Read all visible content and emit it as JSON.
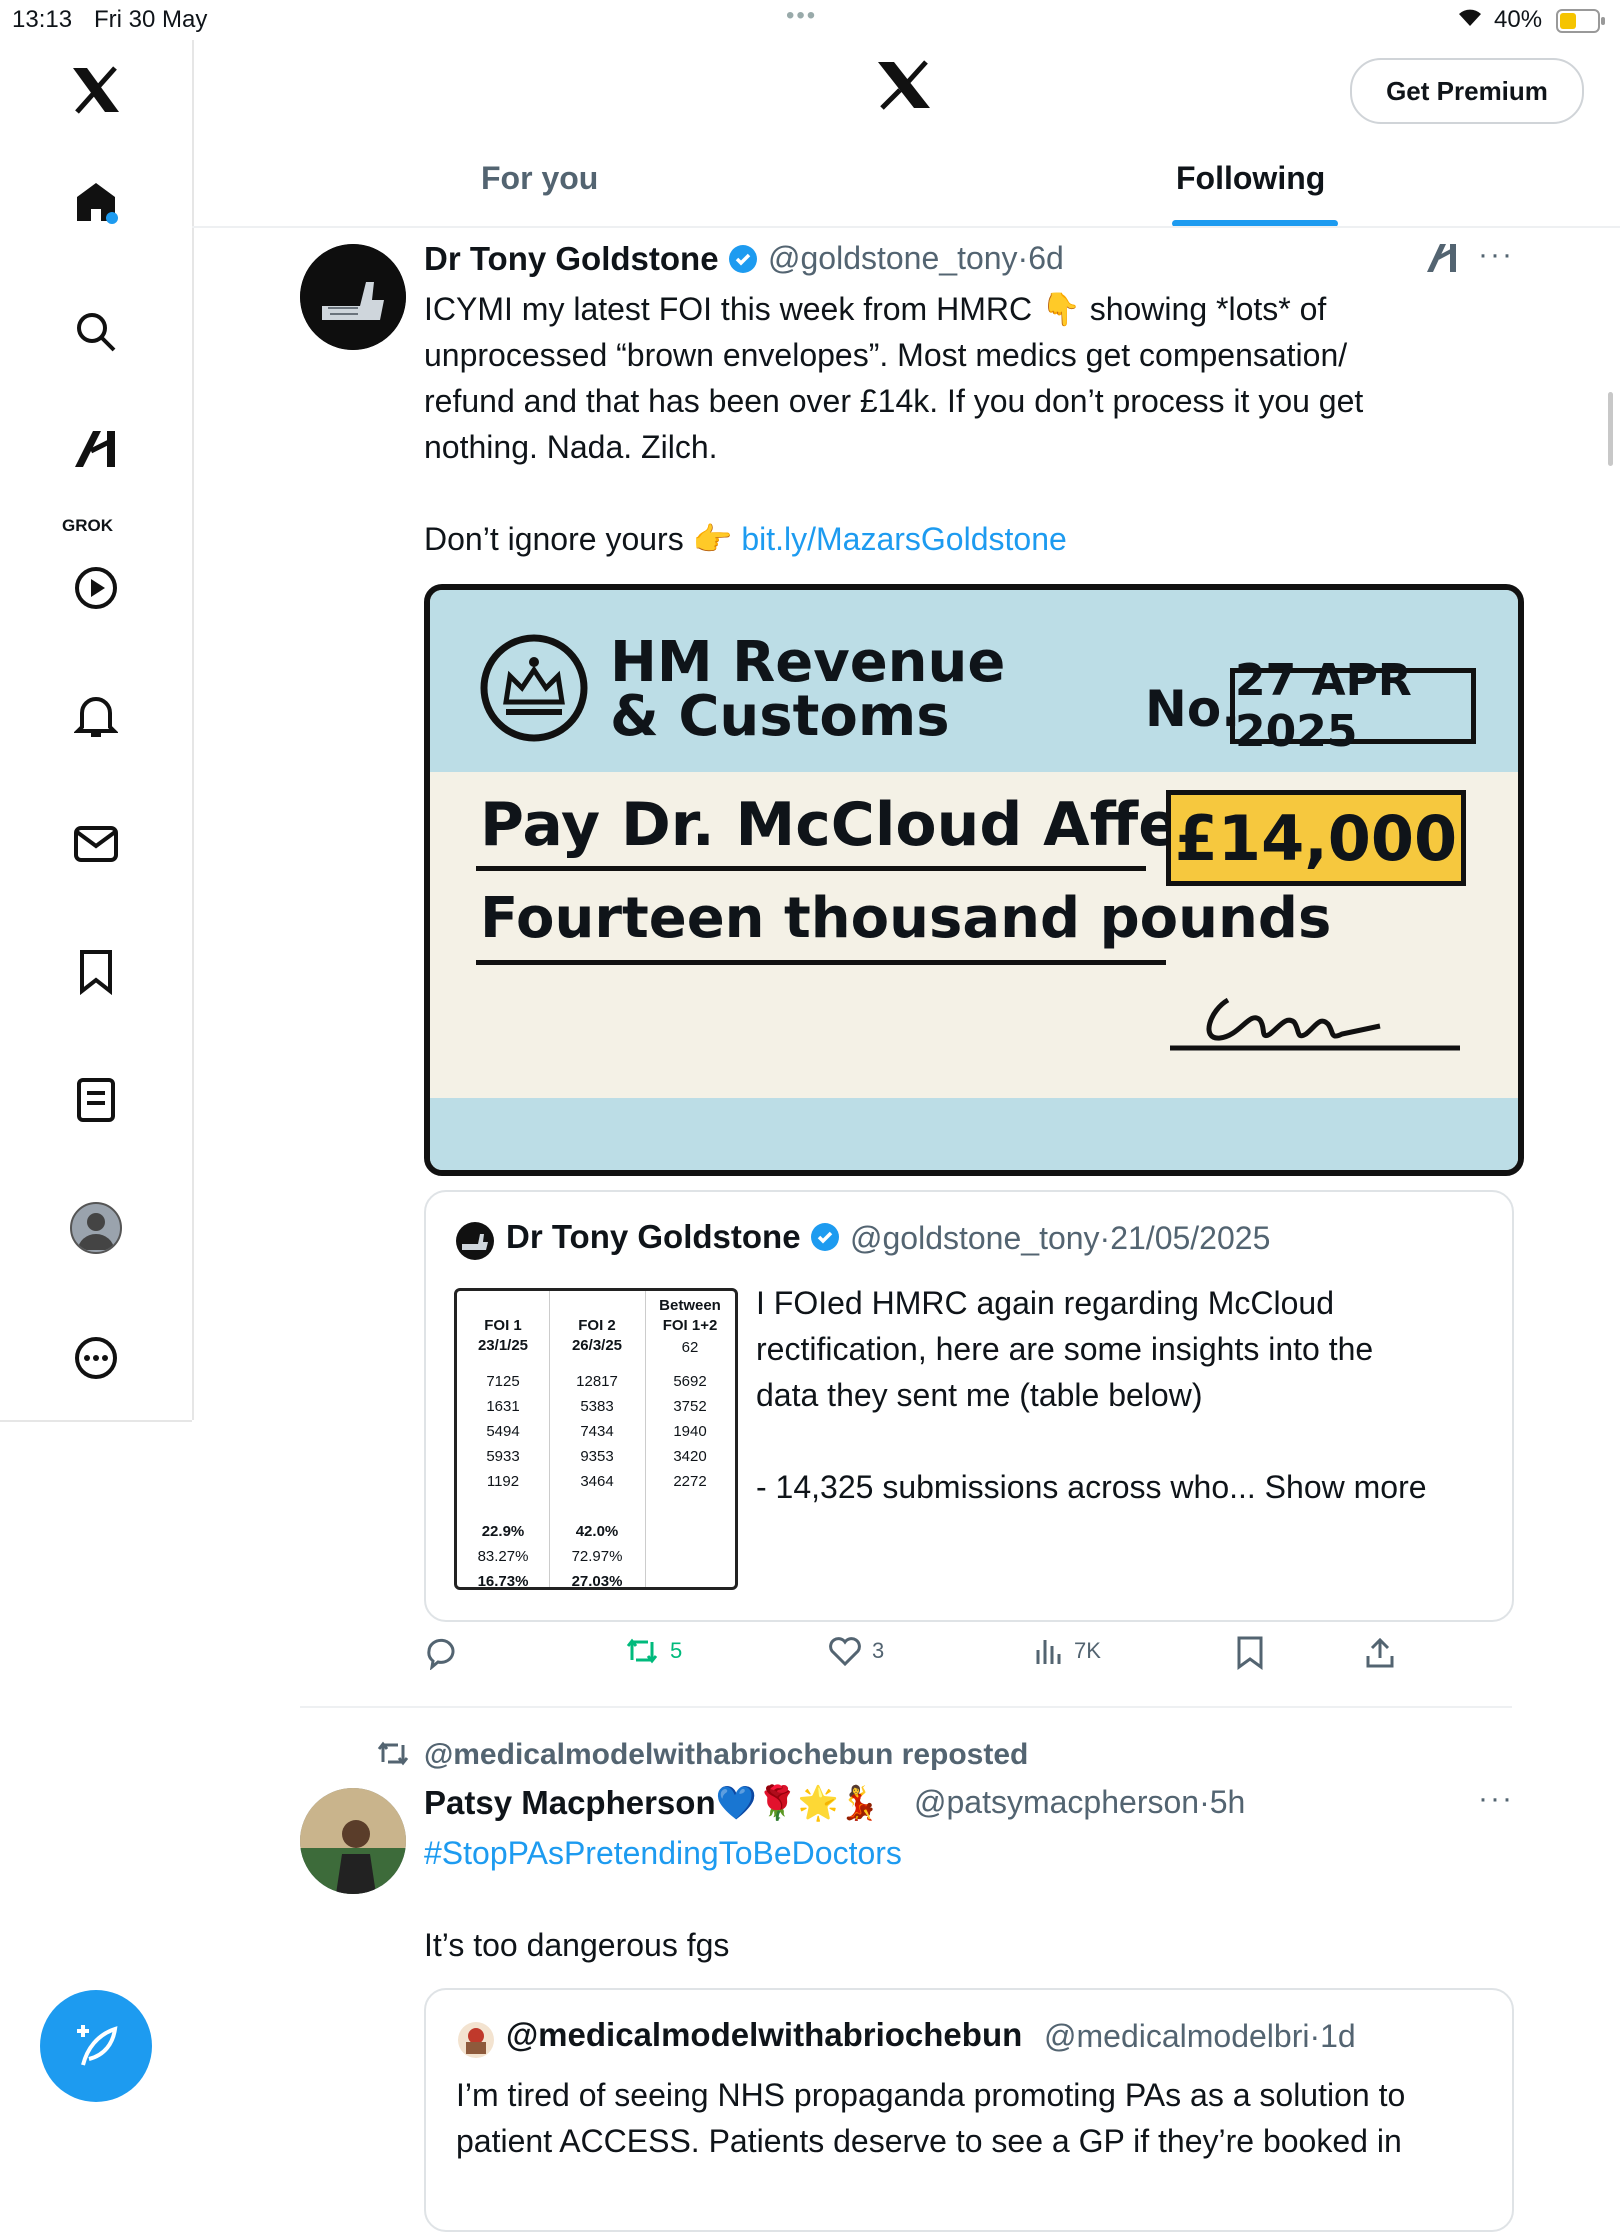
{
  "status_bar": {
    "time": "13:13",
    "date": "Fri 30 May",
    "battery": "40%"
  },
  "nav": {
    "items": [
      "home",
      "explore",
      "grok",
      "video",
      "notifications",
      "messages",
      "bookmarks",
      "lists",
      "profile",
      "more"
    ],
    "grok_label": "GROK"
  },
  "header": {
    "premium_button": "Get Premium",
    "tabs": [
      "For you",
      "Following"
    ],
    "active_tab": "Following"
  },
  "post1": {
    "name": "Dr Tony Goldstone",
    "handle": "@goldstone_tony",
    "time": "6d",
    "text_lines": [
      "ICYMI my latest FOI this week from HMRC 👇 showing *lots* of",
      "unprocessed “brown envelopes”. Most medics get compensation/",
      "refund and that has been over £14k. If you don’t process it you get",
      "nothing. Nada. Zilch."
    ],
    "cta_text": "Don’t ignore yours 👉 ",
    "link": "bit.ly/MazarsGoldstone",
    "cheque": {
      "issuer_line1": "HM Revenue",
      "issuer_line2": "& Customs",
      "no_label": "No.",
      "date": "27 APR 2025",
      "pay_line": "Pay Dr. McCloud Affected",
      "amount": "£14,000",
      "amount_words": "Fourteen thousand pounds"
    },
    "quote": {
      "name": "Dr Tony Goldstone",
      "handle": "@goldstone_tony",
      "date": "21/05/2025",
      "text_lines": [
        "I FOIed HMRC again regarding McCloud",
        "rectification, here are some insights into the",
        "data they sent me (table below)"
      ],
      "last_line": "- 14,325 submissions across who...",
      "show_more": "Show more",
      "table": {
        "headers": [
          [
            "FOI 1",
            "23/1/25"
          ],
          [
            "FOI 2",
            "26/3/25"
          ],
          [
            "Between",
            "FOI 1+2"
          ]
        ],
        "rows": [
          [
            "",
            "",
            "62"
          ],
          [
            "7125",
            "12817",
            "5692"
          ],
          [
            "1631",
            "5383",
            "3752"
          ],
          [
            "5494",
            "7434",
            "1940"
          ],
          [
            "5933",
            "9353",
            "3420"
          ],
          [
            "1192",
            "3464",
            "2272"
          ],
          [
            "22.9%",
            "42.0%",
            ""
          ],
          [
            "83.27%",
            "72.97%",
            ""
          ],
          [
            "16.73%",
            "27.03%",
            ""
          ]
        ]
      }
    },
    "actions": {
      "replies": "",
      "reposts": "5",
      "likes": "3",
      "views": "7K"
    }
  },
  "post2": {
    "repost_label": "@medicalmodelwithabriochebun reposted",
    "name": "Patsy Macpherson💙🌹🌟💃",
    "handle": "@patsymacpherson",
    "time": "5h",
    "hashtag": "#StopPAsPretendingToBeDoctors",
    "text": "It’s too dangerous fgs",
    "quote": {
      "name": "@medicalmodelwithabriochebun",
      "handle": "@medicalmodelbri",
      "time": "1d",
      "text_lines": [
        "I’m tired of seeing NHS propaganda promoting PAs as a solution to",
        "patient ACCESS. Patients deserve  to see a GP if they’re booked in"
      ]
    }
  },
  "colors": {
    "accent": "#1d9bf0",
    "repost_green": "#00ba7c",
    "muted": "#536471"
  }
}
